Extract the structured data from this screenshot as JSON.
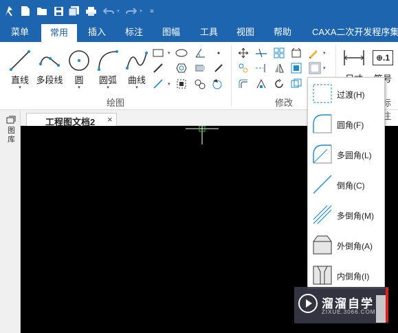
{
  "menu": {
    "tabs": [
      {
        "label": "菜单",
        "active": false
      },
      {
        "label": "常用",
        "active": true
      },
      {
        "label": "插入",
        "active": false
      },
      {
        "label": "标注",
        "active": false
      },
      {
        "label": "图幅",
        "active": false
      },
      {
        "label": "工具",
        "active": false
      },
      {
        "label": "视图",
        "active": false
      },
      {
        "label": "帮助",
        "active": false
      },
      {
        "label": "CAXA二次开发程序集",
        "active": false
      }
    ]
  },
  "ribbon": {
    "draw_buttons": [
      {
        "label": "直线",
        "icon": "line-icon"
      },
      {
        "label": "多段线",
        "icon": "polyline-icon"
      },
      {
        "label": "圆",
        "icon": "circle-icon"
      },
      {
        "label": "圆弧",
        "icon": "arc-icon"
      },
      {
        "label": "曲线",
        "icon": "spline-icon"
      }
    ],
    "draw_group_label": "绘图",
    "modify_group_label": "修改",
    "right_buttons": [
      {
        "label": "尺寸",
        "icon": "dimension-icon"
      },
      {
        "label": "符号",
        "icon": "symbol-icon"
      }
    ],
    "annotate_group_label": "标注",
    "symbol_icon_text": "⊕.1"
  },
  "document": {
    "tab_title": "工程图文档2",
    "close_glyph": "×",
    "left_panel_label": "图库"
  },
  "dropdown": {
    "items": [
      {
        "label": "过渡(H)",
        "icon": "transition-icon"
      },
      {
        "label": "圆角(F)",
        "icon": "fillet-icon"
      },
      {
        "label": "多圆角(L)",
        "icon": "multi-fillet-icon"
      },
      {
        "label": "倒角(C)",
        "icon": "chamfer-icon"
      },
      {
        "label": "多倒角(M)",
        "icon": "multi-chamfer-icon"
      },
      {
        "label": "外倒角(A)",
        "icon": "outer-chamfer-icon"
      },
      {
        "label": "内倒角(I)",
        "icon": "inner-chamfer-icon"
      }
    ]
  },
  "watermark": {
    "title": "溜溜自学",
    "url": "ZIXUE.3066.COM"
  },
  "colors": {
    "titlebar": "#1e65b0",
    "canvas": "#000000",
    "icon_blue": "#1b8ad1",
    "accent_red": "#e0201e"
  }
}
